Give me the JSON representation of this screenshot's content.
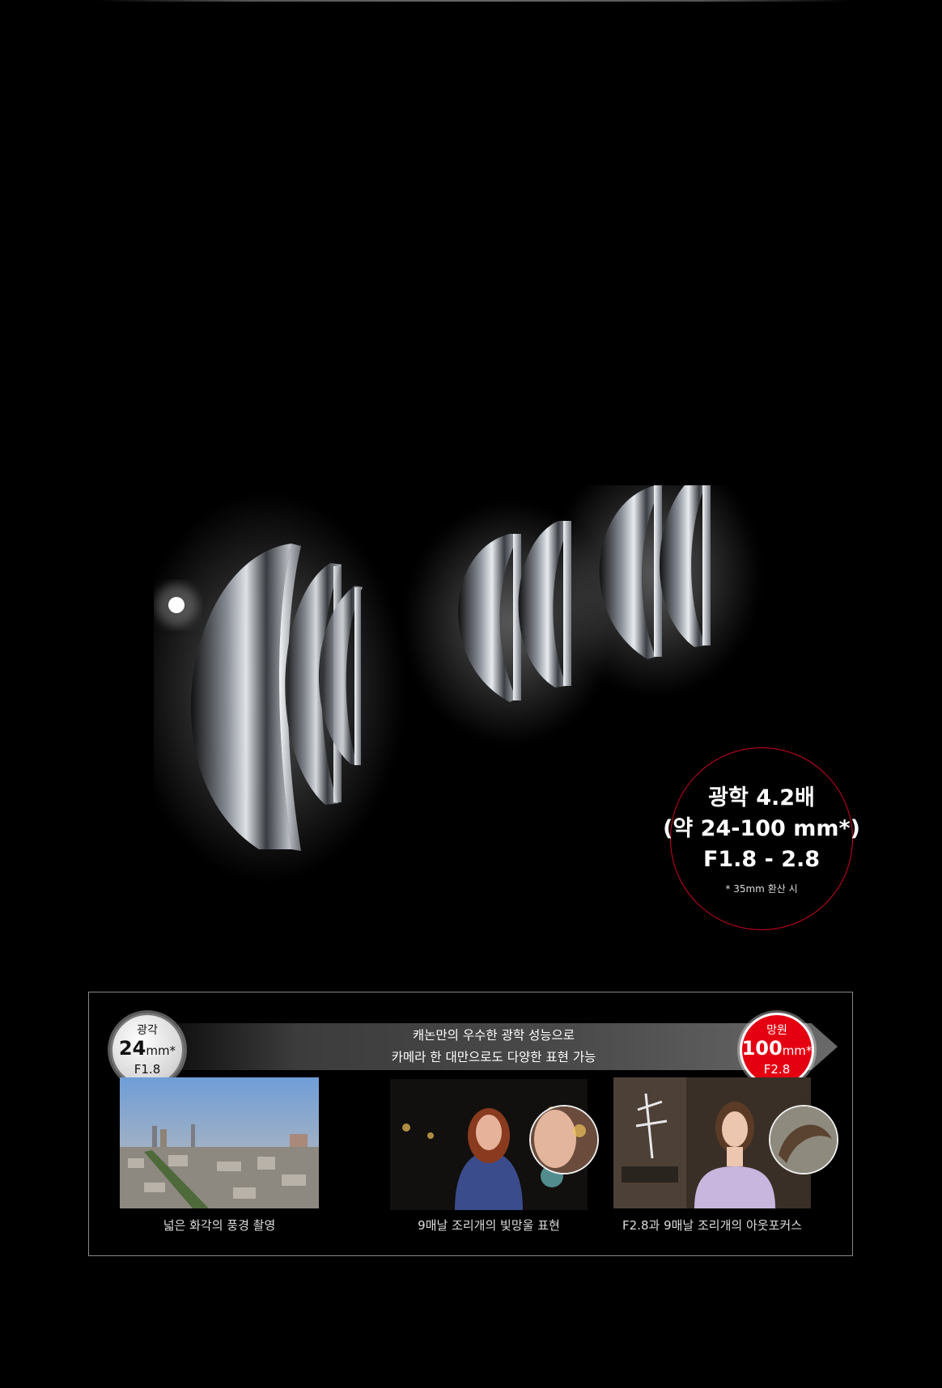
{
  "spec": {
    "zoom": "광학 4.2배",
    "range": "(약 24-100 mm*)",
    "aperture": "F1.8 - 2.8",
    "note": "* 35mm 환산 시"
  },
  "banner": {
    "line1": "캐논만의 우수한 광학 성능으로",
    "line2": "카메라 한 대만으로도 다양한 표현 가능"
  },
  "wide_badge": {
    "label": "광각",
    "value": "24",
    "unit": "mm*",
    "aperture": "F1.8"
  },
  "tele_badge": {
    "label": "망원",
    "value": "100",
    "unit": "mm*",
    "aperture": "F2.8"
  },
  "captions": {
    "wide": "넓은 화각의 풍경 촬영",
    "bokeh": "9매날 조리개의 빛망울 표현",
    "portrait": "F2.8과 9매날 조리개의 아웃포커스"
  },
  "colors": {
    "accent_red": "#d0021b",
    "badge_red": "#e40011"
  }
}
